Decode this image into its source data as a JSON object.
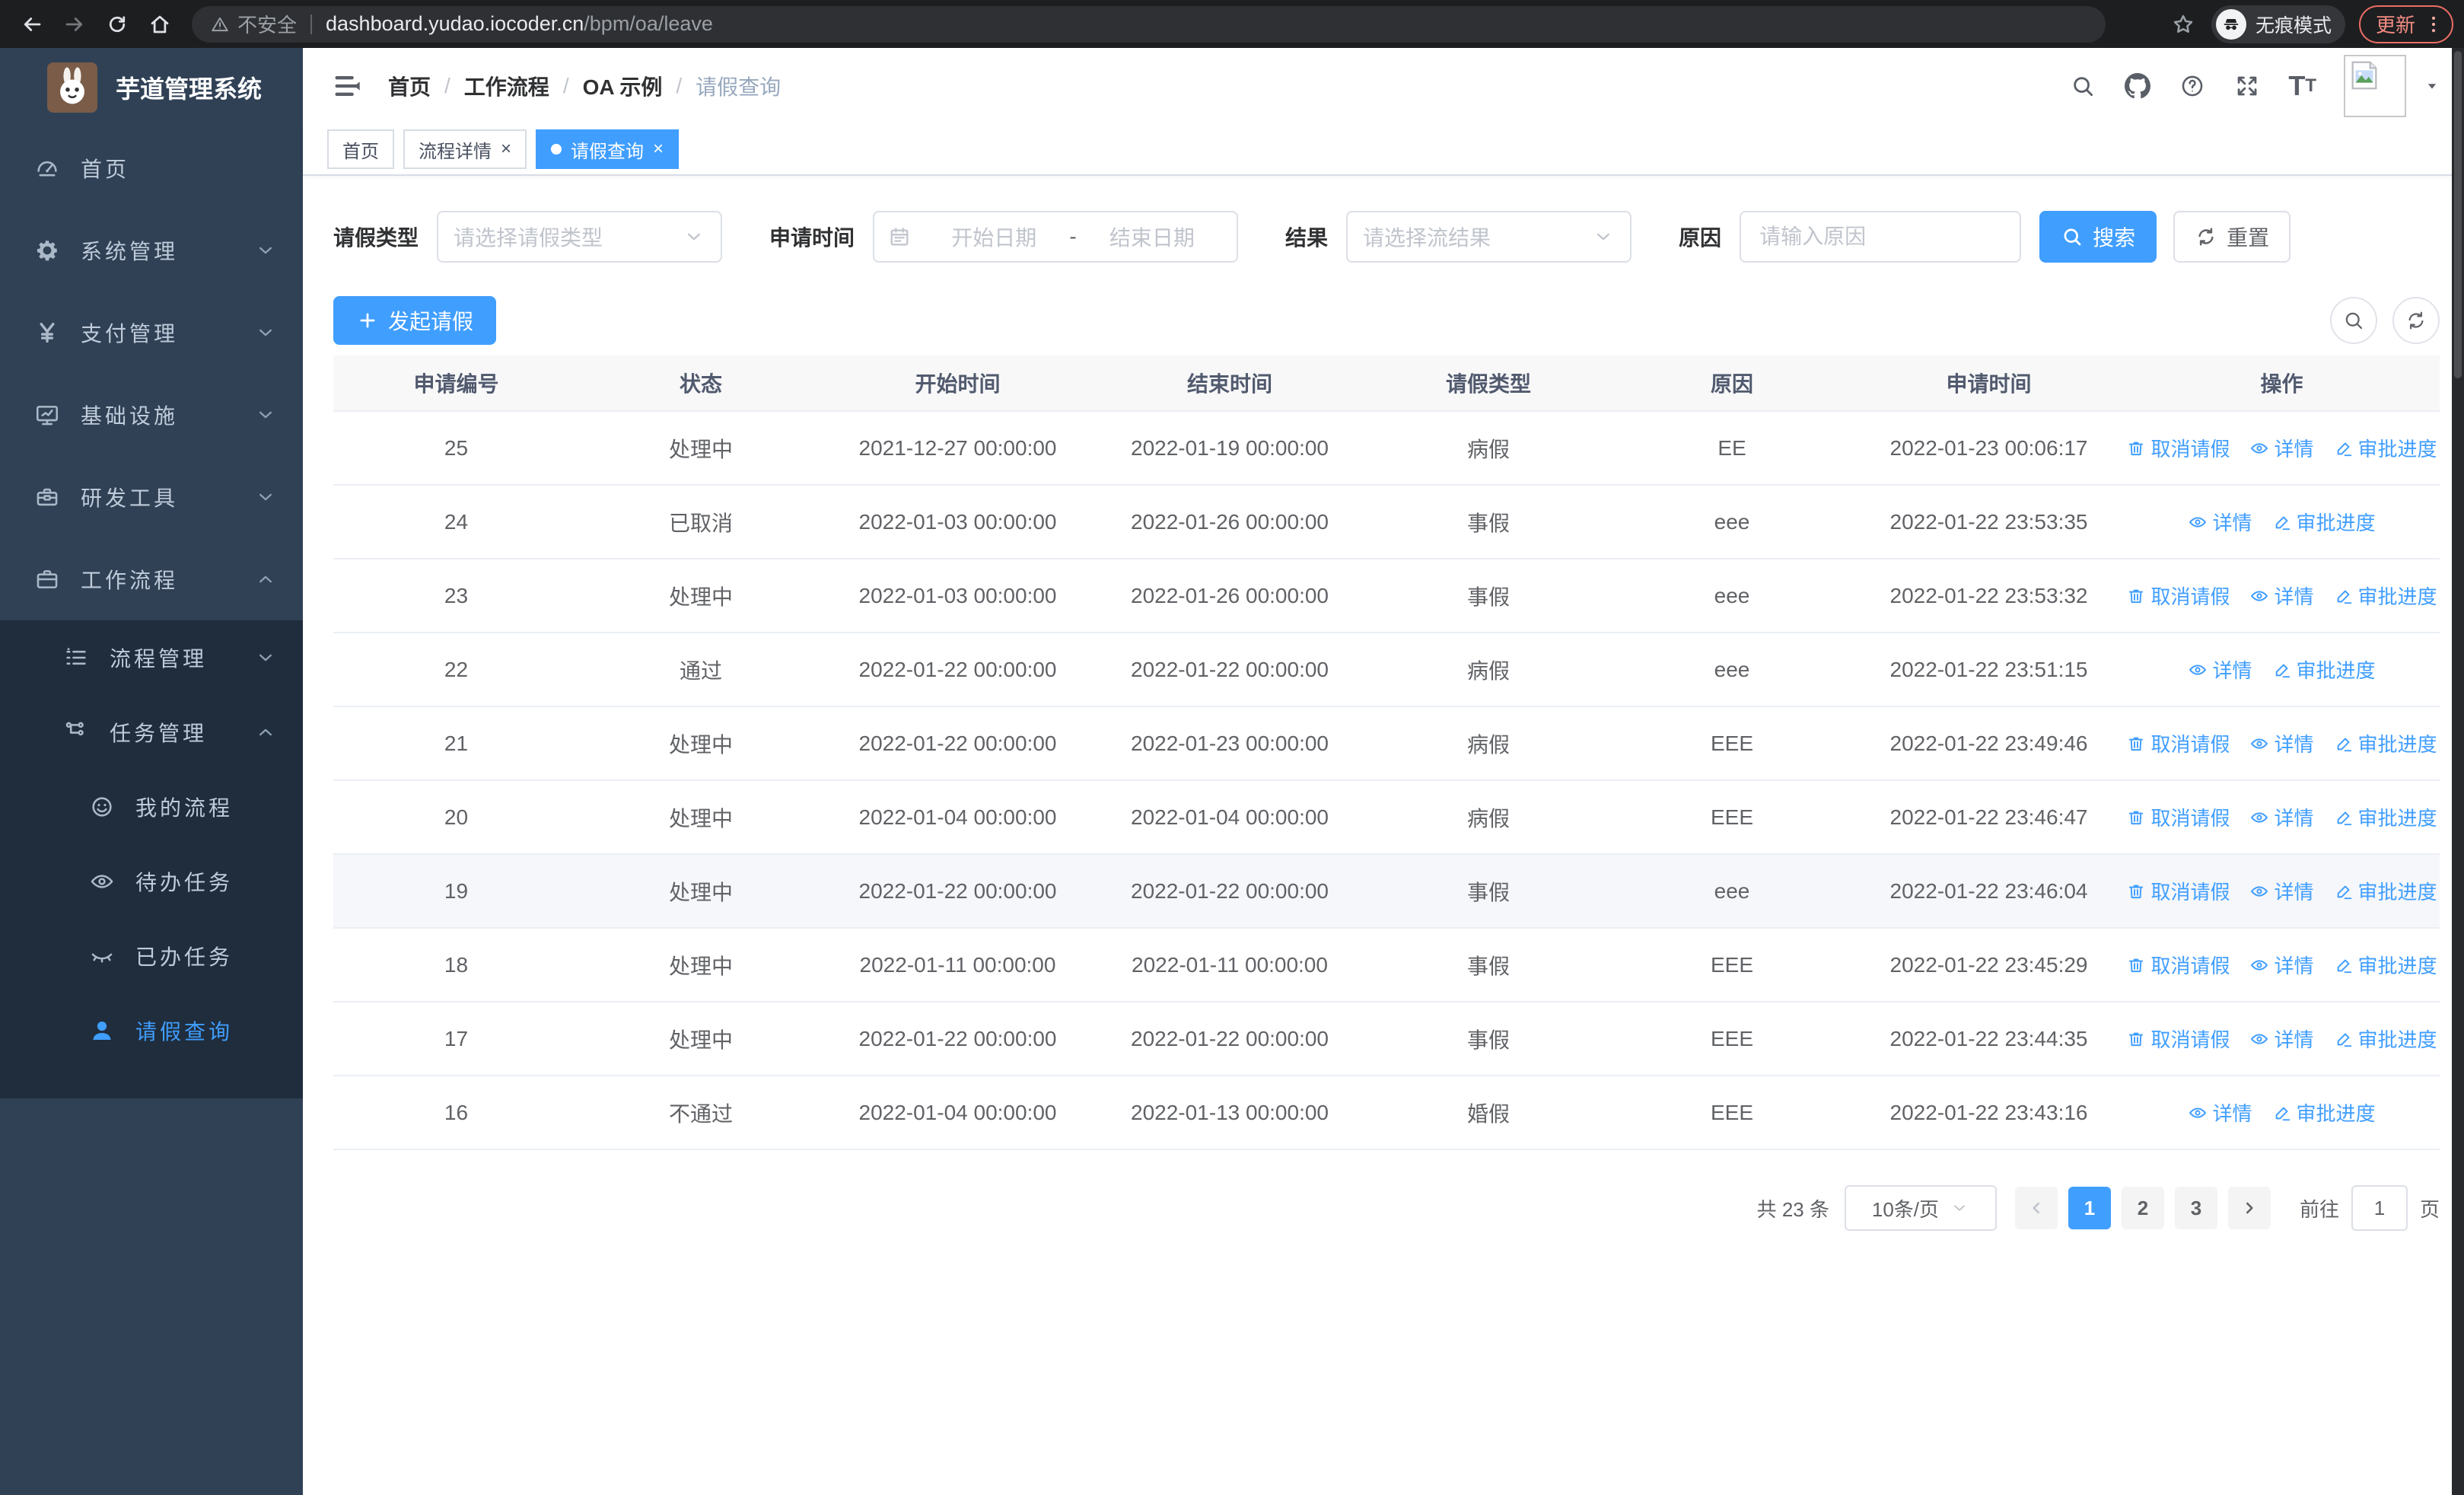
{
  "browser": {
    "security_label": "不安全",
    "url_host": "dashboard.yudao.iocoder.cn",
    "url_path": "/bpm/oa/leave",
    "incognito_label": "无痕模式",
    "update_label": "更新"
  },
  "sidebar": {
    "app_title": "芋道管理系统",
    "items": [
      {
        "key": "home",
        "label": "首页",
        "icon": "dashboard-icon",
        "level": 1,
        "chevron": null,
        "dark": false,
        "active": false
      },
      {
        "key": "system",
        "label": "系统管理",
        "icon": "gear-icon",
        "level": 1,
        "chevron": "down",
        "dark": false,
        "active": false
      },
      {
        "key": "payment",
        "label": "支付管理",
        "icon": "yen-icon",
        "level": 1,
        "chevron": "down",
        "dark": false,
        "active": false
      },
      {
        "key": "infrastructure",
        "label": "基础设施",
        "icon": "monitor-icon",
        "level": 1,
        "chevron": "down",
        "dark": false,
        "active": false
      },
      {
        "key": "dev-tools",
        "label": "研发工具",
        "icon": "toolbox-icon",
        "level": 1,
        "chevron": "down",
        "dark": false,
        "active": false
      },
      {
        "key": "workflow",
        "label": "工作流程",
        "icon": "briefcase-icon",
        "level": 1,
        "chevron": "up",
        "dark": false,
        "active": false
      },
      {
        "key": "process-mgmt",
        "label": "流程管理",
        "icon": "list-tree-icon",
        "level": 2,
        "chevron": "down",
        "dark": true,
        "active": false
      },
      {
        "key": "task-mgmt",
        "label": "任务管理",
        "icon": "flow-icon",
        "level": 2,
        "chevron": "up",
        "dark": true,
        "active": false
      },
      {
        "key": "my-process",
        "label": "我的流程",
        "icon": "face-icon",
        "level": 3,
        "chevron": null,
        "dark": true,
        "active": false
      },
      {
        "key": "todo-tasks",
        "label": "待办任务",
        "icon": "eye-open-icon",
        "level": 3,
        "chevron": null,
        "dark": true,
        "active": false
      },
      {
        "key": "done-tasks",
        "label": "已办任务",
        "icon": "eye-closed-icon",
        "level": 3,
        "chevron": null,
        "dark": true,
        "active": false
      },
      {
        "key": "leave-query",
        "label": "请假查询",
        "icon": "user-icon",
        "level": 3,
        "chevron": null,
        "dark": true,
        "active": true
      }
    ]
  },
  "header": {
    "breadcrumb": [
      "首页",
      "工作流程",
      "OA 示例",
      "请假查询"
    ],
    "separator": "/"
  },
  "tabs": [
    {
      "key": "home",
      "label": "首页",
      "active": false,
      "closable": false
    },
    {
      "key": "process-detail",
      "label": "流程详情",
      "active": false,
      "closable": true
    },
    {
      "key": "leave-query",
      "label": "请假查询",
      "active": true,
      "closable": true
    }
  ],
  "filters": {
    "leave_type_label": "请假类型",
    "leave_type_placeholder": "请选择请假类型",
    "apply_time_label": "申请时间",
    "date_start_placeholder": "开始日期",
    "date_separator": "-",
    "date_end_placeholder": "结束日期",
    "result_label": "结果",
    "result_placeholder": "请选择流结果",
    "reason_label": "原因",
    "reason_placeholder": "请输入原因",
    "search_label": "搜索",
    "reset_label": "重置"
  },
  "toolbar": {
    "create_label": "发起请假"
  },
  "table": {
    "columns": [
      {
        "key": "id",
        "label": "申请编号"
      },
      {
        "key": "status",
        "label": "状态"
      },
      {
        "key": "start",
        "label": "开始时间"
      },
      {
        "key": "end",
        "label": "结束时间"
      },
      {
        "key": "type",
        "label": "请假类型"
      },
      {
        "key": "reason",
        "label": "原因"
      },
      {
        "key": "applied",
        "label": "申请时间"
      },
      {
        "key": "actions",
        "label": "操作"
      }
    ],
    "action_labels": {
      "cancel": "取消请假",
      "detail": "详情",
      "progress": "审批进度"
    },
    "rows": [
      {
        "id": "25",
        "status": "处理中",
        "start": "2021-12-27 00:00:00",
        "end": "2022-01-19 00:00:00",
        "type": "病假",
        "reason": "EE",
        "applied": "2022-01-23 00:06:17",
        "can_cancel": true,
        "hover": false
      },
      {
        "id": "24",
        "status": "已取消",
        "start": "2022-01-03 00:00:00",
        "end": "2022-01-26 00:00:00",
        "type": "事假",
        "reason": "eee",
        "applied": "2022-01-22 23:53:35",
        "can_cancel": false,
        "hover": false
      },
      {
        "id": "23",
        "status": "处理中",
        "start": "2022-01-03 00:00:00",
        "end": "2022-01-26 00:00:00",
        "type": "事假",
        "reason": "eee",
        "applied": "2022-01-22 23:53:32",
        "can_cancel": true,
        "hover": false
      },
      {
        "id": "22",
        "status": "通过",
        "start": "2022-01-22 00:00:00",
        "end": "2022-01-22 00:00:00",
        "type": "病假",
        "reason": "eee",
        "applied": "2022-01-22 23:51:15",
        "can_cancel": false,
        "hover": false
      },
      {
        "id": "21",
        "status": "处理中",
        "start": "2022-01-22 00:00:00",
        "end": "2022-01-23 00:00:00",
        "type": "病假",
        "reason": "EEE",
        "applied": "2022-01-22 23:49:46",
        "can_cancel": true,
        "hover": false
      },
      {
        "id": "20",
        "status": "处理中",
        "start": "2022-01-04 00:00:00",
        "end": "2022-01-04 00:00:00",
        "type": "病假",
        "reason": "EEE",
        "applied": "2022-01-22 23:46:47",
        "can_cancel": true,
        "hover": false
      },
      {
        "id": "19",
        "status": "处理中",
        "start": "2022-01-22 00:00:00",
        "end": "2022-01-22 00:00:00",
        "type": "事假",
        "reason": "eee",
        "applied": "2022-01-22 23:46:04",
        "can_cancel": true,
        "hover": true
      },
      {
        "id": "18",
        "status": "处理中",
        "start": "2022-01-11 00:00:00",
        "end": "2022-01-11 00:00:00",
        "type": "事假",
        "reason": "EEE",
        "applied": "2022-01-22 23:45:29",
        "can_cancel": true,
        "hover": false
      },
      {
        "id": "17",
        "status": "处理中",
        "start": "2022-01-22 00:00:00",
        "end": "2022-01-22 00:00:00",
        "type": "事假",
        "reason": "EEE",
        "applied": "2022-01-22 23:44:35",
        "can_cancel": true,
        "hover": false
      },
      {
        "id": "16",
        "status": "不通过",
        "start": "2022-01-04 00:00:00",
        "end": "2022-01-13 00:00:00",
        "type": "婚假",
        "reason": "EEE",
        "applied": "2022-01-22 23:43:16",
        "can_cancel": false,
        "hover": false
      }
    ]
  },
  "pagination": {
    "total_label": "共 23 条",
    "page_size": "10条/页",
    "pages": [
      "1",
      "2",
      "3"
    ],
    "active_page": "1",
    "goto_label": "前往",
    "goto_value": "1",
    "goto_suffix": "页"
  },
  "colors": {
    "primary": "#409eff",
    "sidebar_bg": "#304156",
    "submenu_bg": "#1f2d3d",
    "tab_active": "#409eff",
    "update_accent": "#f28b82",
    "table_header_bg": "#f8f8f9",
    "hover_row_bg": "#f5f7fa"
  }
}
